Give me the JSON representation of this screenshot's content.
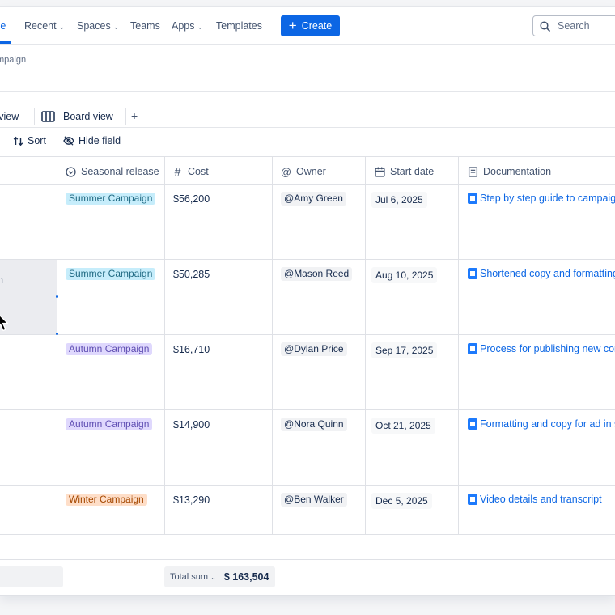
{
  "nav": {
    "items": [
      {
        "label": "me",
        "chevron": false
      },
      {
        "label": "Recent",
        "chevron": true
      },
      {
        "label": "Spaces",
        "chevron": true
      },
      {
        "label": "Teams",
        "chevron": false
      },
      {
        "label": "Apps",
        "chevron": true
      },
      {
        "label": "Templates",
        "chevron": false
      }
    ],
    "create_label": "Create",
    "search_placeholder": "Search"
  },
  "breadcrumb": "mpaign",
  "views": [
    {
      "label": "l view",
      "icon": "table-icon"
    },
    {
      "label": "Board view",
      "icon": "board-icon"
    }
  ],
  "add_view_label": "+",
  "toolbar": {
    "sort_label": "Sort",
    "hide_field_label": "Hide field"
  },
  "columns": [
    {
      "label": "Seasonal release",
      "icon": "status-icon"
    },
    {
      "label": "Cost",
      "icon": "hash-icon"
    },
    {
      "label": "Owner",
      "icon": "at-icon"
    },
    {
      "label": "Start date",
      "icon": "calendar-icon"
    },
    {
      "label": "Documentation",
      "icon": "doc-field-icon"
    }
  ],
  "rows": [
    {
      "first": "",
      "season": "Summer Campaign",
      "season_kind": "summer",
      "cost": "$56,200",
      "owner": "Amy Green",
      "start": "Jul 6, 2025",
      "doc": "Step by step guide to campaig..."
    },
    {
      "first": "n",
      "season": "Summer Campaign",
      "season_kind": "summer",
      "cost": "$50,285",
      "owner": "Mason Reed",
      "start": "Aug 10, 2025",
      "doc": "Shortened copy and formatting"
    },
    {
      "first": "",
      "season": "Autumn Campaign",
      "season_kind": "autumn",
      "cost": "$16,710",
      "owner": "Dylan Price",
      "start": "Sep 17, 2025",
      "doc": "Process for publishing new con"
    },
    {
      "first": "",
      "season": "Autumn Campaign",
      "season_kind": "autumn",
      "cost": "$14,900",
      "owner": "Nora Quinn",
      "start": "Oct 21, 2025",
      "doc": "Formatting and copy for ad in s"
    },
    {
      "first": "",
      "season": "Winter Campaign",
      "season_kind": "winter",
      "cost": "$13,290",
      "owner": "Ben Walker",
      "start": "Dec 5, 2025",
      "doc": "Video details and transcript"
    }
  ],
  "mention_prefix": "@",
  "footer": {
    "total_label": "Total sum",
    "total_value": "$ 163,504"
  },
  "colors": {
    "accent": "#0c66e4",
    "summer": "#c6edfb",
    "autumn": "#dfd8fd",
    "winter": "#fedec8"
  }
}
